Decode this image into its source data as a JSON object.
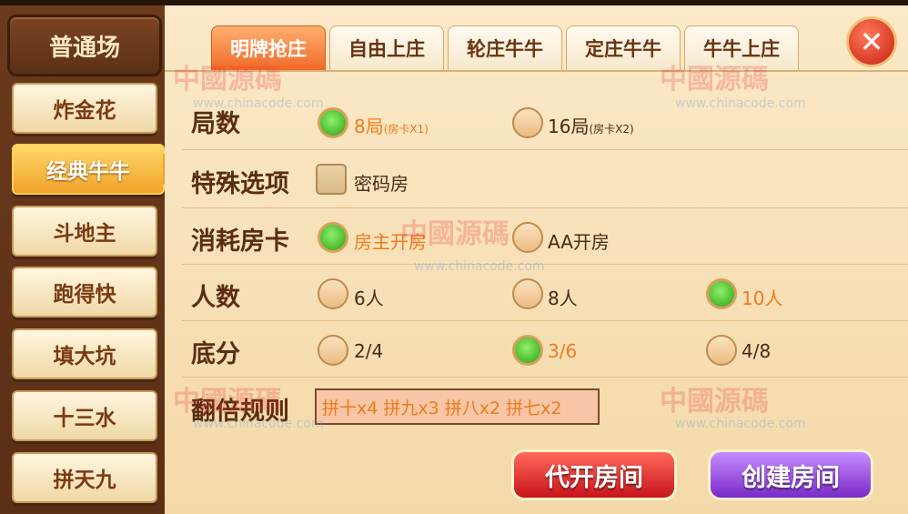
{
  "sidebar": {
    "title": "普通场",
    "games": [
      "炸金花",
      "经典牛牛",
      "斗地主",
      "跑得快",
      "填大坑",
      "十三水",
      "拼天九"
    ],
    "active_index": 1
  },
  "tabs": [
    "明牌抢庄",
    "自由上庄",
    "轮庄牛牛",
    "定庄牛牛",
    "牛牛上庄"
  ],
  "active_tab": 0,
  "close_icon": "close-icon",
  "rows": {
    "rounds": {
      "label": "局数",
      "options": [
        {
          "text": "8局",
          "note": "(房卡X1)",
          "selected": true
        },
        {
          "text": "16局",
          "note": "(房卡X2)",
          "selected": false
        }
      ]
    },
    "special": {
      "label": "特殊选项",
      "checkbox_label": "密码房",
      "checked": false
    },
    "cost": {
      "label": "消耗房卡",
      "options": [
        {
          "text": "房主开房",
          "selected": true
        },
        {
          "text": "AA开房",
          "selected": false
        }
      ]
    },
    "players": {
      "label": "人数",
      "options": [
        {
          "text": "6人",
          "selected": false
        },
        {
          "text": "8人",
          "selected": false
        },
        {
          "text": "10人",
          "selected": true
        }
      ]
    },
    "base": {
      "label": "底分",
      "options": [
        {
          "text": "2/4",
          "selected": false
        },
        {
          "text": "3/6",
          "selected": true
        },
        {
          "text": "4/8",
          "selected": false
        }
      ]
    },
    "multiplier": {
      "label": "翻倍规则",
      "value": "拼十x4 拼九x3 拼八x2 拼七x2"
    }
  },
  "buttons": {
    "proxy": "代开房间",
    "create": "创建房间"
  },
  "watermark": {
    "text": "中國源碼",
    "url": "www.chinacode.com"
  },
  "colors": {
    "selected_text": "#f07a1e",
    "active_tab": "#f06a28",
    "radio_on": "#2aa016"
  }
}
